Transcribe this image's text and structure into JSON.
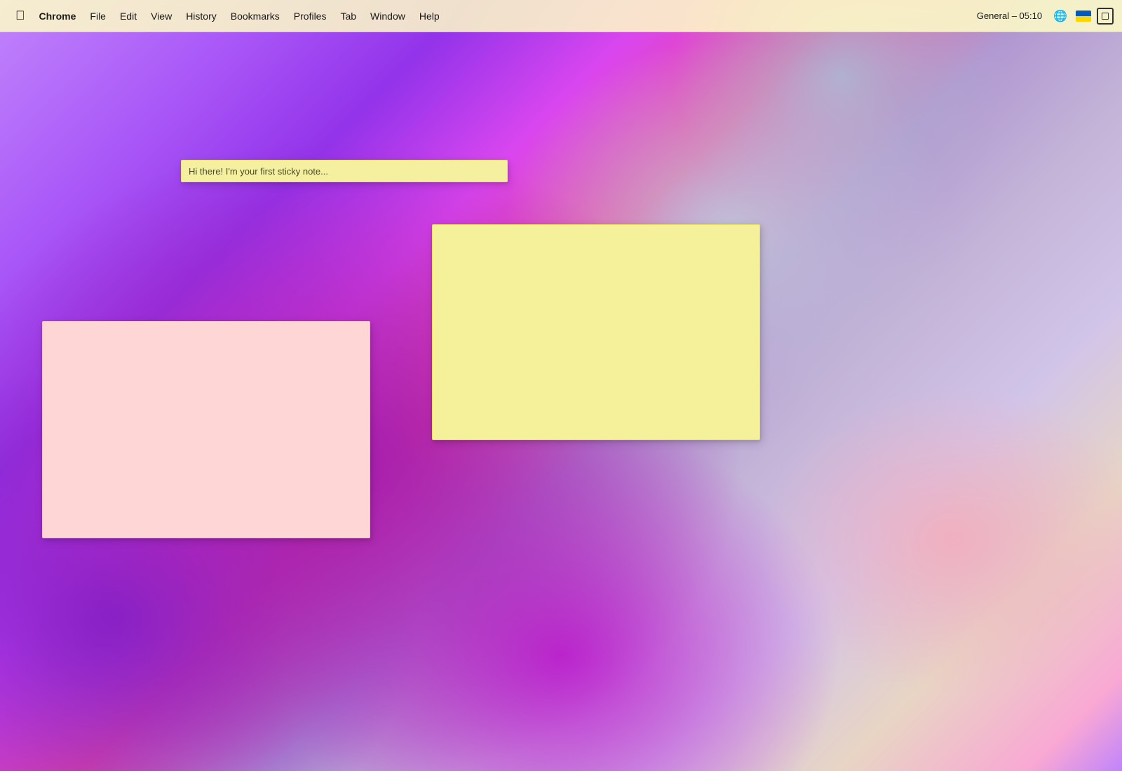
{
  "menubar": {
    "apple_symbol": "⌘",
    "items": [
      {
        "id": "chrome",
        "label": "Chrome",
        "bold": true
      },
      {
        "id": "file",
        "label": "File"
      },
      {
        "id": "edit",
        "label": "Edit"
      },
      {
        "id": "view",
        "label": "View"
      },
      {
        "id": "history",
        "label": "History"
      },
      {
        "id": "bookmarks",
        "label": "Bookmarks"
      },
      {
        "id": "profiles",
        "label": "Profiles"
      },
      {
        "id": "tab",
        "label": "Tab"
      },
      {
        "id": "window",
        "label": "Window"
      },
      {
        "id": "help",
        "label": "Help"
      }
    ],
    "right": {
      "time": "General – 05:10"
    }
  },
  "sticky_notes": {
    "small": {
      "text": "Hi there! I'm your first sticky note..."
    },
    "pink": {
      "text": ""
    },
    "yellow": {
      "text": ""
    }
  }
}
